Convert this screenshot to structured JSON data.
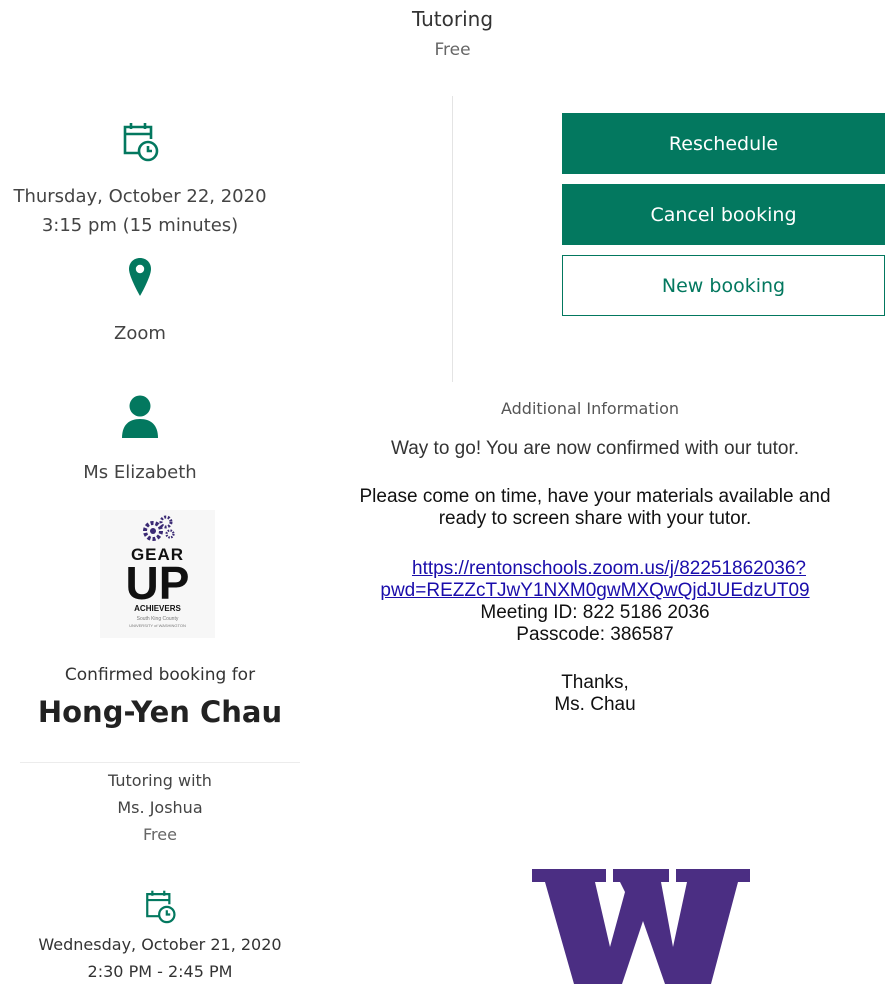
{
  "header": {
    "title": "Tutoring",
    "price": "Free"
  },
  "booking": {
    "date": "Thursday, October 22, 2020",
    "time": "3:15 pm (15 minutes)",
    "location": "Zoom",
    "staff": "Ms Elizabeth"
  },
  "logo": {
    "line1": "GEAR",
    "line2": "UP",
    "line3": "ACHIEVERS",
    "line4": "South King County",
    "line5": "UNIVERSITY of WASHINGTON"
  },
  "confirmation": {
    "label": "Confirmed booking for",
    "name": "Hong-Yen Chau"
  },
  "previous": {
    "line1": "Tutoring with",
    "line2": "Ms. Joshua",
    "price": "Free",
    "date": "Wednesday, October 21, 2020",
    "time": "2:30 PM - 2:45 PM"
  },
  "actions": {
    "reschedule": "Reschedule",
    "cancel": "Cancel booking",
    "new": "New booking"
  },
  "additional": {
    "title": "Additional Information",
    "line1": "Way to go! You are now confirmed with our tutor.",
    "line2": "Please come on time, have your materials available and",
    "line3": "ready to screen share with your tutor.",
    "link_part1": "https://rentonschools.zoom.us/j/82251862036?",
    "link_part2": "pwd=REZZcTJwY1NXM0gwMXQwQjdJUEdzUT09",
    "meeting_id": "Meeting ID: 822 5186 2036",
    "passcode": "Passcode: 386587",
    "thanks": "Thanks,",
    "signature": "Ms. Chau"
  },
  "colors": {
    "accent": "#03785f",
    "uw_purple": "#4b2e83",
    "link": "#1a0dab"
  },
  "icons": [
    "calendar-clock-icon",
    "location-pin-icon",
    "person-icon",
    "gear-up-logo",
    "uw-w-logo"
  ]
}
